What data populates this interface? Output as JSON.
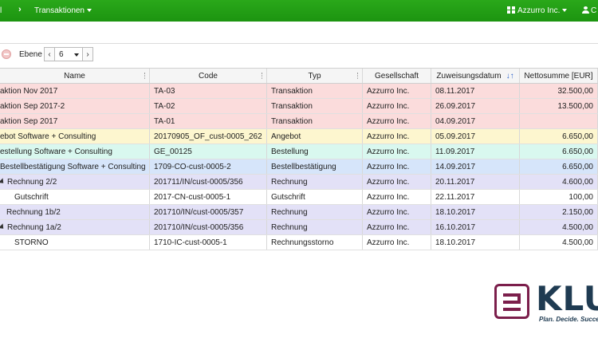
{
  "topbar": {
    "menu_cut": "l",
    "separator": "›",
    "section_label": "Transaktionen",
    "company_label": "Azzurro Inc.",
    "user_label": "C"
  },
  "toolbar": {
    "level_label": "Ebene",
    "level_value": "6",
    "prev_symbol": "‹",
    "next_symbol": "›"
  },
  "table": {
    "columns": [
      "Name",
      "Code",
      "Typ",
      "Gesellschaft",
      "Zuweisungsdatum",
      "Nettosumme [EUR]"
    ],
    "sort_indicator": "↓↑",
    "rows": [
      {
        "name": "aktion Nov 2017",
        "code": "TA-03",
        "type": "Transaktion",
        "company": "Azzurro Inc.",
        "date": "08.11.2017",
        "amount": "32.500,00",
        "color": "#fbdcdc",
        "indent": 0,
        "expander": false
      },
      {
        "name": "aktion Sep 2017-2",
        "code": "TA-02",
        "type": "Transaktion",
        "company": "Azzurro Inc.",
        "date": "26.09.2017",
        "amount": "13.500,00",
        "color": "#fbdcdc",
        "indent": 0,
        "expander": false
      },
      {
        "name": "aktion Sep 2017",
        "code": "TA-01",
        "type": "Transaktion",
        "company": "Azzurro Inc.",
        "date": "04.09.2017",
        "amount": "",
        "color": "#fbdcdc",
        "indent": 0,
        "expander": false
      },
      {
        "name": "ebot Software + Consulting",
        "code": "20170905_OF_cust-0005_262",
        "type": "Angebot",
        "company": "Azzurro Inc.",
        "date": "05.09.2017",
        "amount": "6.650,00",
        "color": "#fdf6cf",
        "indent": 0,
        "expander": false
      },
      {
        "name": "estellung Software + Consulting",
        "code": "GE_00125",
        "type": "Bestellung",
        "company": "Azzurro Inc.",
        "date": "11.09.2017",
        "amount": "6.650,00",
        "color": "#d9f8ef",
        "indent": 0,
        "expander": false
      },
      {
        "name": "Bestellbestätigung Software + Consulting",
        "code": "1709-CO-cust-0005-2",
        "type": "Bestellbestätigung",
        "company": "Azzurro Inc.",
        "date": "14.09.2017",
        "amount": "6.650,00",
        "color": "#d6e5fa",
        "indent": 0,
        "expander": false
      },
      {
        "name": "Rechnung 2/2",
        "code": "201711/IN/cust-0005/356",
        "type": "Rechnung",
        "company": "Azzurro Inc.",
        "date": "20.11.2017",
        "amount": "4.600,00",
        "color": "#e3e1f7",
        "indent": 0,
        "expander": true
      },
      {
        "name": "Gutschrift",
        "code": "2017-CN-cust-0005-1",
        "type": "Gutschrift",
        "company": "Azzurro Inc.",
        "date": "22.11.2017",
        "amount": "100,00",
        "color": "#ffffff",
        "indent": 18,
        "expander": false
      },
      {
        "name": "Rechnung 1b/2",
        "code": "201710/IN/cust-0005/357",
        "type": "Rechnung",
        "company": "Azzurro Inc.",
        "date": "18.10.2017",
        "amount": "2.150,00",
        "color": "#e3e1f7",
        "indent": 8,
        "expander": false
      },
      {
        "name": "Rechnung 1a/2",
        "code": "201710/IN/cust-0005/356",
        "type": "Rechnung",
        "company": "Azzurro Inc.",
        "date": "16.10.2017",
        "amount": "4.500,00",
        "color": "#e3e1f7",
        "indent": 0,
        "expander": true
      },
      {
        "name": "STORNO",
        "code": "1710-IC-cust-0005-1",
        "type": "Rechnungsstorno",
        "company": "Azzurro Inc.",
        "date": "18.10.2017",
        "amount": "4.500,00",
        "color": "#ffffff",
        "indent": 18,
        "expander": false
      }
    ]
  },
  "logo": {
    "wordmark": "KLU",
    "tagline": "Plan. Decide. Succe",
    "brand_color": "#7b1e4b",
    "text_color": "#1f3b52"
  },
  "colors": {
    "topbar": "#1f9a13",
    "sort_arrow": "#3366cc"
  }
}
